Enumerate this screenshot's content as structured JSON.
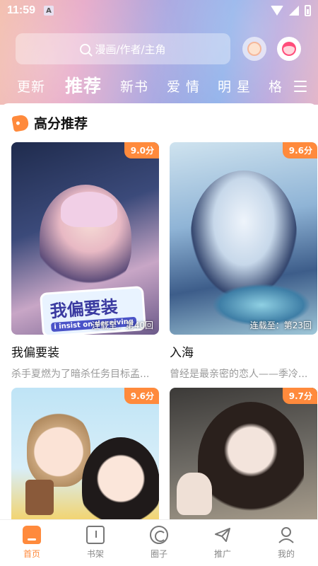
{
  "status_bar": {
    "time": "11:59",
    "indicator": "A"
  },
  "search": {
    "placeholder": "漫画/作者/主角"
  },
  "tabs": [
    {
      "label": "更新"
    },
    {
      "label": "推荐"
    },
    {
      "label": "新书"
    },
    {
      "label": "爱 情"
    },
    {
      "label": "明 星"
    },
    {
      "label": "格"
    }
  ],
  "section": {
    "title": "高分推荐"
  },
  "cards": [
    {
      "title": "我偏要装",
      "score": "9.0分",
      "progress": "连载至：第40回",
      "desc": "杀手夏燃为了暗杀任务目标孟...",
      "logo_main": "我偏要装",
      "logo_sub": "i insist on deceiving"
    },
    {
      "title": "入海",
      "score": "9.6分",
      "progress": "连载至：第23回",
      "desc": "曾经是最亲密的恋人——季冷..."
    },
    {
      "score": "9.6分"
    },
    {
      "score": "9.7分"
    }
  ],
  "bottom_nav": [
    {
      "label": "首页",
      "icon": "home-icon"
    },
    {
      "label": "书架",
      "icon": "bookshelf-icon"
    },
    {
      "label": "圈子",
      "icon": "circle-icon"
    },
    {
      "label": "推广",
      "icon": "promote-icon"
    },
    {
      "label": "我的",
      "icon": "profile-icon"
    }
  ],
  "colors": {
    "accent": "#ff8a3c"
  }
}
